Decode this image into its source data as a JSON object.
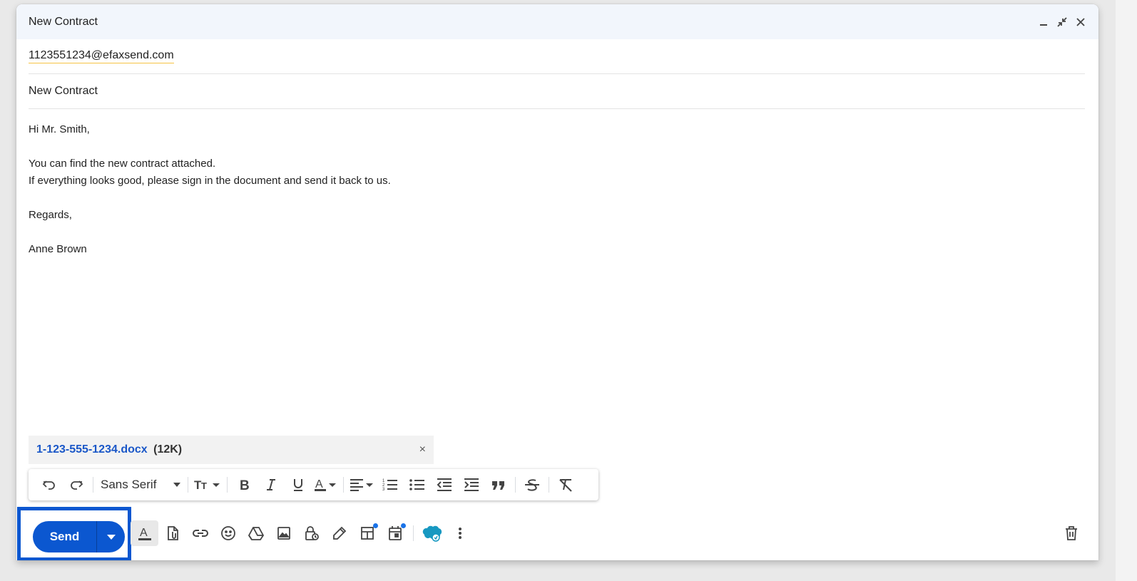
{
  "window": {
    "title": "New Contract"
  },
  "recipients": {
    "to": "1123551234@efaxsend.com"
  },
  "subject": "New Contract",
  "body": {
    "lines": [
      "Hi Mr. Smith,",
      "",
      "You can find the new contract attached.",
      "If everything looks good, please sign in the document and send it back to us.",
      "",
      "Regards,",
      "",
      "Anne Brown"
    ]
  },
  "attachment": {
    "name": "1-123-555-1234.docx",
    "size": "(12K)",
    "close": "×"
  },
  "formatting": {
    "font": "Sans Serif"
  },
  "send": {
    "label": "Send"
  },
  "colors": {
    "accent": "#0b57d0",
    "title_bar": "#f2f6fc",
    "notification_dot": "#1a73e8"
  }
}
